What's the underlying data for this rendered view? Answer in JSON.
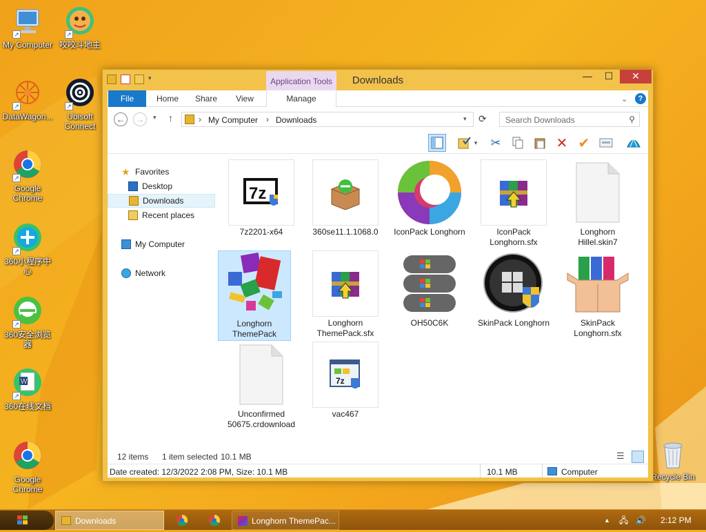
{
  "desktop": {
    "icons": [
      {
        "label": "My Computer",
        "icon": "monitor-icon"
      },
      {
        "label": "咬咬斗地主",
        "icon": "game-face-icon"
      },
      {
        "label": "DataWagon...",
        "icon": "datawagon-icon"
      },
      {
        "label": "Ubisoft Connect",
        "icon": "ubisoft-icon"
      },
      {
        "label": "Google Chrome",
        "icon": "chrome-icon"
      },
      {
        "label": "360小程序中心",
        "icon": "360-applet-icon"
      },
      {
        "label": "360安全浏览器",
        "icon": "360-browser-icon"
      },
      {
        "label": "360在线文档",
        "icon": "360-docs-icon"
      },
      {
        "label": "Google Chrome",
        "icon": "chrome-icon"
      },
      {
        "label": "Recycle Bin",
        "icon": "recycle-bin-icon"
      }
    ]
  },
  "window": {
    "title": "Downloads",
    "context_tab": "Application Tools",
    "controls": {
      "minimize": "—",
      "maximize": "☐",
      "close": "✕"
    }
  },
  "ribbon": {
    "tabs": [
      "File",
      "Home",
      "Share",
      "View",
      "Manage"
    ],
    "help": "?"
  },
  "address": {
    "crumbs": [
      "My Computer",
      "Downloads"
    ],
    "search_placeholder": "Search Downloads"
  },
  "nav": {
    "favorites": "Favorites",
    "desktop": "Desktop",
    "downloads": "Downloads",
    "recent": "Recent places",
    "computer": "My Computer",
    "network": "Network"
  },
  "files": [
    {
      "name": "7z2201-x64",
      "icon": "7zip-installer-icon"
    },
    {
      "name": "360se11.1.1068.0",
      "icon": "360-installer-box-icon"
    },
    {
      "name": "IconPack Longhorn",
      "icon": "iconpack-swirl-icon"
    },
    {
      "name": "IconPack Longhorn.sfx",
      "icon": "winrar-sfx-icon"
    },
    {
      "name": "Longhorn Hillel.skin7",
      "icon": "blank-file-icon"
    },
    {
      "name": "Longhorn ThemePack",
      "icon": "themepack-icon",
      "selected": true
    },
    {
      "name": "Longhorn ThemePack.sfx",
      "icon": "winrar-sfx-icon"
    },
    {
      "name": "OH50C6K",
      "icon": "windows-stack-icon"
    },
    {
      "name": "SkinPack Longhorn",
      "icon": "windows-orb-shield-icon"
    },
    {
      "name": "SkinPack Longhorn.sfx",
      "icon": "skinpack-box-icon"
    },
    {
      "name": "Unconfirmed 50675.crdownload",
      "icon": "blank-file-icon"
    },
    {
      "name": "vac467",
      "icon": "7zip-window-icon"
    }
  ],
  "status": {
    "items": "12 items",
    "selection": "1 item selected",
    "size": "10.1 MB"
  },
  "details": {
    "info": "Date created: 12/3/2022 2:08 PM, Size: 10.1 MB",
    "size": "10.1 MB",
    "location": "Computer"
  },
  "taskbar": {
    "tasks": [
      "Downloads",
      "Longhorn ThemePac..."
    ],
    "time": "2:12 PM"
  },
  "colors": {
    "desktop": "#f5b420",
    "window_frame": "#f2c24a",
    "accent": "#1979ca",
    "close": "#c7413b",
    "selection": "#cce8ff"
  }
}
